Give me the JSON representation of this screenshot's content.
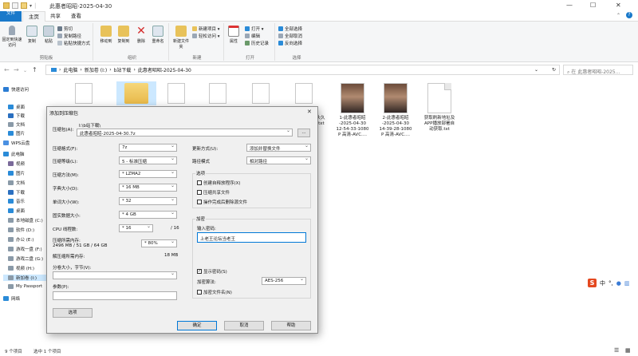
{
  "window": {
    "title": "此惠者昭昭-2025-04-30",
    "controls": [
      "—",
      "☐",
      "✕"
    ]
  },
  "ribbon": {
    "tabs": [
      "文件",
      "主页",
      "共享",
      "查看"
    ],
    "clipboard": {
      "pin": "固定到快速访问",
      "copy": "复制",
      "paste": "粘贴",
      "cut": "剪切",
      "copy_path": "复制路径",
      "paste_shortcut": "粘贴快捷方式",
      "label": "剪贴板"
    },
    "organize": {
      "move_to": "移动到",
      "copy_to": "复制到",
      "delete": "删除",
      "rename": "重命名",
      "label": "组织"
    },
    "new": {
      "new_folder": "新建文件夹",
      "new_item": "新建项目 ▾",
      "easy_access": "轻松访问 ▾",
      "label": "新建"
    },
    "open": {
      "properties": "属性",
      "open": "打开 ▾",
      "edit": "编辑",
      "history": "历史记录",
      "label": "打开"
    },
    "select": {
      "select_all": "全部选择",
      "select_none": "全部取消",
      "invert": "反向选择",
      "label": "选择"
    }
  },
  "address": {
    "crumbs": [
      "此电脑",
      "新加卷 (I:)",
      "b站下载",
      "此惠者昭昭-2025-04-30"
    ],
    "search_placeholder": "在 此惠者昭昭-2025..."
  },
  "nav": {
    "items": [
      {
        "label": "快速访问",
        "color": "#2b7cd3"
      },
      {
        "label": "桌面",
        "color": "#2a8bd8"
      },
      {
        "label": "下载",
        "color": "#2a6fc0"
      },
      {
        "label": "文档",
        "color": "#8a9aa8"
      },
      {
        "label": "图片",
        "color": "#2a8bd8"
      },
      {
        "label": "WPS云盘",
        "color": "#4a90e2"
      },
      {
        "label": "此电脑",
        "color": "#2a8bd8"
      },
      {
        "label": "视频",
        "color": "#7a6a9a"
      },
      {
        "label": "图片",
        "color": "#2a8bd8"
      },
      {
        "label": "文档",
        "color": "#8a9aa8"
      },
      {
        "label": "下载",
        "color": "#2a6fc0"
      },
      {
        "label": "音乐",
        "color": "#2a8bd8"
      },
      {
        "label": "桌面",
        "color": "#2a8bd8"
      },
      {
        "label": "本地磁盘 (C:)",
        "color": "#8a9aa8"
      },
      {
        "label": "软件 (D:)",
        "color": "#8a9aa8"
      },
      {
        "label": "办公 (E:)",
        "color": "#8a9aa8"
      },
      {
        "label": "游戏一盘 (F:)",
        "color": "#8a9aa8"
      },
      {
        "label": "游戏二盘 (G:)",
        "color": "#8a9aa8"
      },
      {
        "label": "视频 (H:)",
        "color": "#8a9aa8"
      },
      {
        "label": "新加卷 (I:)",
        "color": "#8a9aa8"
      },
      {
        "label": "My Passport",
        "color": "#8a9aa8"
      },
      {
        "label": "网络",
        "color": "#2a8bd8"
      }
    ]
  },
  "files": [
    {
      "name": "头久\n.txt",
      "kind": "doc"
    },
    {
      "name": "1-此惠者昭昭\n-2025-04-30\n12-54-33-1080\nP 高清-AVC....",
      "kind": "thumb"
    },
    {
      "name": "2-此惠者昭昭\n-2025-04-30\n14-39-28-1080\nP 高清-AVC....",
      "kind": "thumb"
    },
    {
      "name": "获取刷新地址及\nAPP播放部署自\n动获取.txt",
      "kind": "doc"
    }
  ],
  "status": {
    "count": "9 个项目",
    "selected": "选中 1 个项目"
  },
  "ime": {
    "lang": "中",
    "punct": "°,"
  },
  "dialog": {
    "title": "添加到压缩包",
    "archive_label": "压缩包(A):",
    "archive_dir": "I:\\b站下载\\",
    "archive_name": "此惠者昭昭-2025-04-30.7z",
    "browse": "...",
    "format_label": "压缩格式(F):",
    "format": "7z",
    "level_label": "压缩等级(L):",
    "level": "5 - 标准压缩",
    "method_label": "压缩方法(M):",
    "method": "* LZMA2",
    "dict_label": "字典大小(D):",
    "dict": "* 16 MB",
    "word_label": "单词大小(W):",
    "word": "* 32",
    "solid_label": "固实数据大小:",
    "solid": "* 4 GB",
    "cpu_label": "CPU 线程数:",
    "cpu": "* 16",
    "cpu_max": "/ 16",
    "mem_label": "压缩所需内存:",
    "mem_detail": "2496 MB / 51 GB / 64 GB",
    "mem_pct": "* 80%",
    "demem_label": "解压缩所需内存:",
    "demem": "18 MB",
    "split_label": "分卷大小，字节(V):",
    "params_label": "参数(P):",
    "options_btn": "选项",
    "update_label": "更新方式(U):",
    "update": "添加并替换文件",
    "pathmode_label": "路径模式",
    "pathmode": "相对路径",
    "options_title": "选项",
    "opt_sfx": "创建自释放程序(X)",
    "opt_shared": "压缩共享文件",
    "opt_delete": "操作完成后删除源文件",
    "enc_title": "加密",
    "pwd_label": "输入密码:",
    "password": "上老王论坛当老王",
    "show_pwd": "显示密码(S)",
    "enc_method_label": "加密算法:",
    "enc_method": "AES-256",
    "enc_names": "加密文件名(N)",
    "ok": "确定",
    "cancel": "取消",
    "help": "帮助"
  }
}
